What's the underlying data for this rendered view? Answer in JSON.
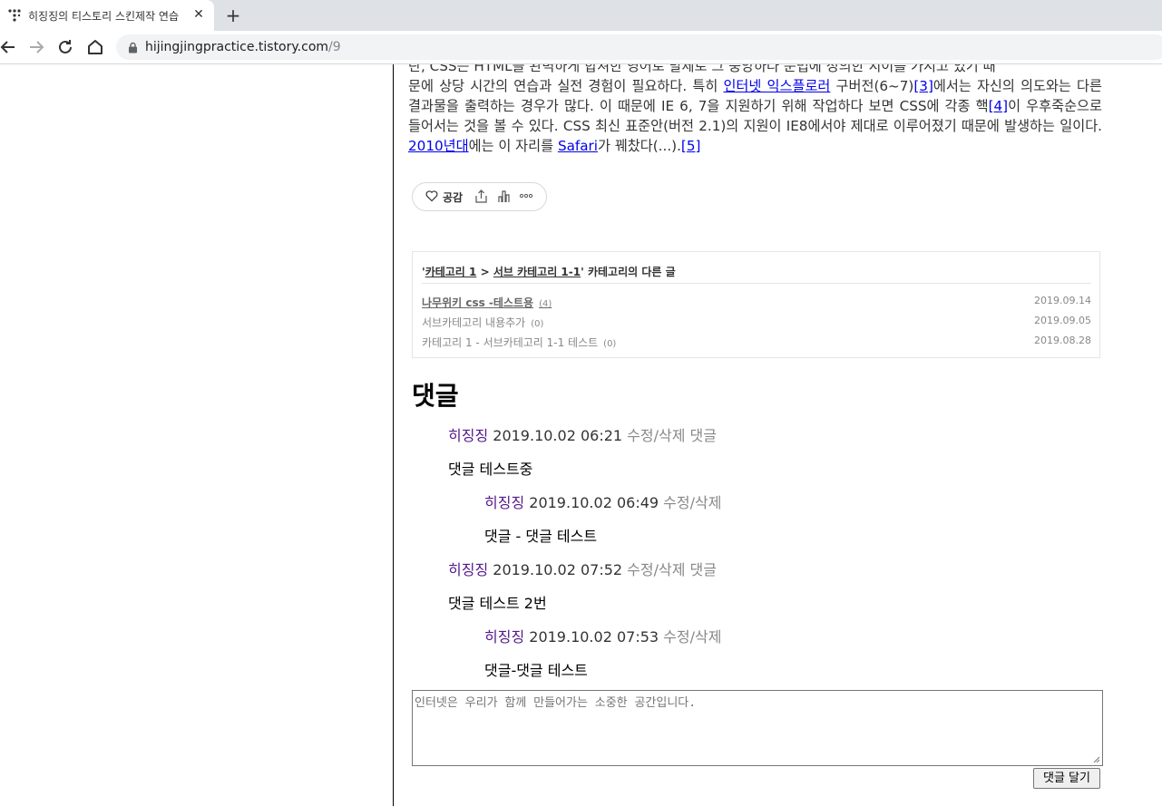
{
  "browser": {
    "tab_title": "히징징의 티스토리 스킨제작 연습",
    "url_host": "hijingjingpractice.tistory.com",
    "url_path": "/9"
  },
  "article": {
    "line1": "란, CSS는 HTML을 완벽하게 합쳐한 영어로 발제로 그 중앙하다 문법에 정의한 치이를 가지고 있기 때",
    "seg_a": "문에 상당 시간의 연습과 실전 경험이 필요하다. 특히 ",
    "link_ie": "인터넷 익스플로러",
    "seg_b": " 구버전(6~7)",
    "ref3": "[3]",
    "seg_c": "에서는 자신의 의도와는 다른 결과물을 출력하는 경우가 많다. 이 때문에 IE 6, 7을 지원하기 위해 작업하다 보면 CSS에 각종 핵",
    "ref4": "[4]",
    "seg_d": "이 우후죽순으로 들어서는 것을 볼 수 있다. CSS 최신 표준안(버전 2.1)의 지원이 IE8에서야 제대로 이루어졌기 때문에 발생하는 일이다. ",
    "link_2010": "2010년대",
    "seg_e": "에는 이 자리를 ",
    "link_safari": "Safari",
    "seg_f": "가 꿰찼다(...).",
    "ref5": "[5]"
  },
  "actions": {
    "like_label": "공감"
  },
  "related": {
    "quote_open": "'",
    "cat1": "카테고리 1",
    "sep": " > ",
    "cat2": "서브 카테고리 1-1",
    "suffix": "' 카테고리의 다른 글",
    "items": [
      {
        "title": "나무위키 css -테스트용",
        "count": "(4)",
        "date": "2019.09.14"
      },
      {
        "title": "서브카테고리 내용추가",
        "count": "(0)",
        "date": "2019.09.05"
      },
      {
        "title": "카테고리 1 - 서브카테고리 1-1 테스트",
        "count": "(0)",
        "date": "2019.08.28"
      }
    ]
  },
  "comments": {
    "heading": "댓글",
    "list": [
      {
        "author": "히징징",
        "time": "2019.10.02 06:21",
        "actions": "수정/삭제 댓글",
        "body": "댓글 테스트중"
      },
      {
        "author": "히징징",
        "time": "2019.10.02 06:49",
        "actions": "수정/삭제",
        "body": "댓글 - 댓글 테스트"
      },
      {
        "author": "히징징",
        "time": "2019.10.02 07:52",
        "actions": "수정/삭제 댓글",
        "body": "댓글 테스트 2번"
      },
      {
        "author": "히징징",
        "time": "2019.10.02 07:53",
        "actions": "수정/삭제",
        "body": "댓글-댓글 테스트"
      }
    ],
    "placeholder": "인터넷은 우리가 함께 만들어가는 소중한 공간입니다.",
    "submit_label": "댓글 달기"
  }
}
